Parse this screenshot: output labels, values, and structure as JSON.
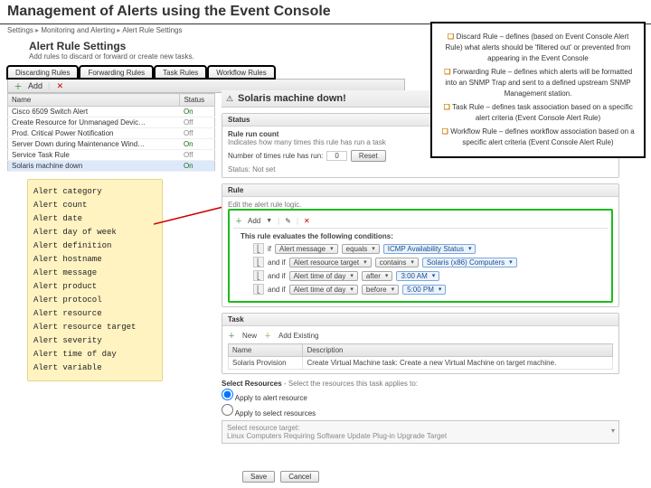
{
  "slide": {
    "title": "Management of Alerts using the Event Console"
  },
  "breadcrumb": [
    "Settings",
    "Monitoring and Alerting",
    "Alert Rule Settings"
  ],
  "page": {
    "header": "Alert Rule Settings",
    "sub": "Add rules to discard or forward or create new tasks."
  },
  "tabs": [
    "Discarding Rules",
    "Forwarding Rules",
    "Task Rules",
    "Workflow Rules"
  ],
  "toolbar": {
    "add": "Add",
    "delete": "✕"
  },
  "rules": {
    "cols": [
      "Name",
      "Status"
    ],
    "rows": [
      {
        "name": "Cisco 6509 Switch Alert",
        "status": "On"
      },
      {
        "name": "Create Resource for Unmanaged Devic…",
        "status": "Off"
      },
      {
        "name": "Prod. Critical Power Notification",
        "status": "Off"
      },
      {
        "name": "Server Down during Maintenance Wind…",
        "status": "On"
      },
      {
        "name": "Service Task Rule",
        "status": "Off"
      },
      {
        "name": "Solaris machine down",
        "status": "On"
      }
    ]
  },
  "categories": [
    "Alert category",
    "Alert count",
    "Alert date",
    "Alert day of week",
    "Alert definition",
    "Alert hostname",
    "Alert message",
    "Alert product",
    "Alert protocol",
    "Alert resource",
    "Alert resource target",
    "Alert severity",
    "Alert time of day",
    "Alert variable"
  ],
  "detail": {
    "title": "Solaris machine down!",
    "status_block": "Status",
    "run_label": "Rule run count",
    "run_desc": "Indicates how many times this rule has run a task",
    "run_count_label": "Number of times rule has run:",
    "run_count": "0",
    "reset": "Reset",
    "status_text": "Status: Not set"
  },
  "rule_block": {
    "title": "Rule",
    "desc": "Edit the alert rule logic.",
    "add": "Add",
    "pencil": "✎",
    "del": "✕",
    "eval": "This rule evaluates the following conditions:",
    "rows": [
      {
        "pre": "if",
        "field": "Alert message",
        "op": "equals",
        "value": "ICMP Availability Status"
      },
      {
        "pre": "and if",
        "field": "Alert resource target",
        "op": "contains",
        "value": "Solaris (x86) Computers"
      },
      {
        "pre": "and if",
        "field": "Alert time of day",
        "op": "after",
        "value": "3:00 AM"
      },
      {
        "pre": "and if",
        "field": "Alert time of day",
        "op": "before",
        "value": "5:00 PM"
      }
    ]
  },
  "task_block": {
    "title": "Task",
    "new": "New",
    "existing": "Add Existing",
    "cols": [
      "Name",
      "Description"
    ],
    "rows": [
      {
        "name": "Solaris Provision",
        "desc": "Create Virtual Machine task: Create a new Virtual Machine on target machine."
      }
    ]
  },
  "selres": {
    "title": "Select Resources",
    "subtitle": "- Select the resources this task applies to:",
    "opt1": "Apply to alert resource",
    "opt2": "Apply to select resources",
    "target_label": "Select resource target:",
    "target_value": "Linux Computers Requiring Software Update Plug-in Upgrade Target"
  },
  "savecancel": {
    "save": "Save",
    "cancel": "Cancel"
  },
  "callout": [
    "Discard Rule – defines (based on Event Console Alert Rule) what alerts should be 'filtered out' or prevented from appearing in the Event Console",
    "Forwarding Rule – defines which alerts will be formatted into an SNMP Trap and sent to a defined upstream SNMP Management station.",
    "Task Rule – defines task association based on a specific alert criteria (Event Console Alert Rule)",
    "Workflow Rule – defines workflow association based on a specific alert criteria (Event Console Alert Rule)"
  ]
}
